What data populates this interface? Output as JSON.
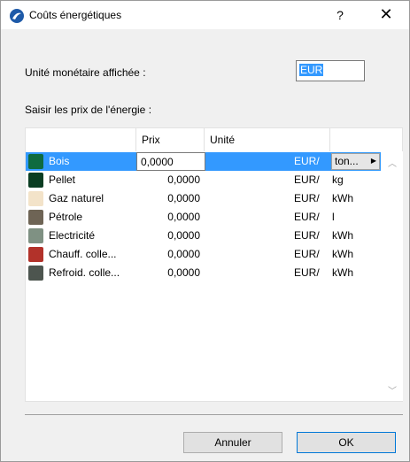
{
  "window": {
    "title": "Coûts énergétiques",
    "help_label": "?",
    "close_label": "✕"
  },
  "currency": {
    "label": "Unité monétaire affichée :",
    "value": "EUR"
  },
  "prices_label": "Saisir les prix de l'énergie :",
  "table": {
    "headers": {
      "name": "",
      "prix": "Prix",
      "unit": "Unité",
      "extra": ""
    },
    "rows": [
      {
        "name": "Bois",
        "prix": "0,0000",
        "unit_currency": "EUR/",
        "unit": "ton...",
        "color": "#0f6b40"
      },
      {
        "name": "Pellet",
        "prix": "0,0000",
        "unit_currency": "EUR/",
        "unit": "kg",
        "color": "#0a3d22"
      },
      {
        "name": "Gaz naturel",
        "prix": "0,0000",
        "unit_currency": "EUR/",
        "unit": "kWh",
        "color": "#f3e3c9"
      },
      {
        "name": "Pétrole",
        "prix": "0,0000",
        "unit_currency": "EUR/",
        "unit": "l",
        "color": "#6e6455"
      },
      {
        "name": "Electricité",
        "prix": "0,0000",
        "unit_currency": "EUR/",
        "unit": "kWh",
        "color": "#7f9183"
      },
      {
        "name": "Chauff. colle...",
        "prix": "0,0000",
        "unit_currency": "EUR/",
        "unit": "kWh",
        "color": "#b2322a"
      },
      {
        "name": "Refroid. colle...",
        "prix": "0,0000",
        "unit_currency": "EUR/",
        "unit": "kWh",
        "color": "#4d554f"
      }
    ],
    "selected_index": 0,
    "dropdown_arrow": "▶",
    "scroll_up": "︿",
    "scroll_down": "﹀"
  },
  "buttons": {
    "cancel": "Annuler",
    "ok": "OK"
  },
  "colors": {
    "selection": "#3399ff",
    "window_bg": "#f0f0f0",
    "app_icon": "#1e5aa8"
  }
}
